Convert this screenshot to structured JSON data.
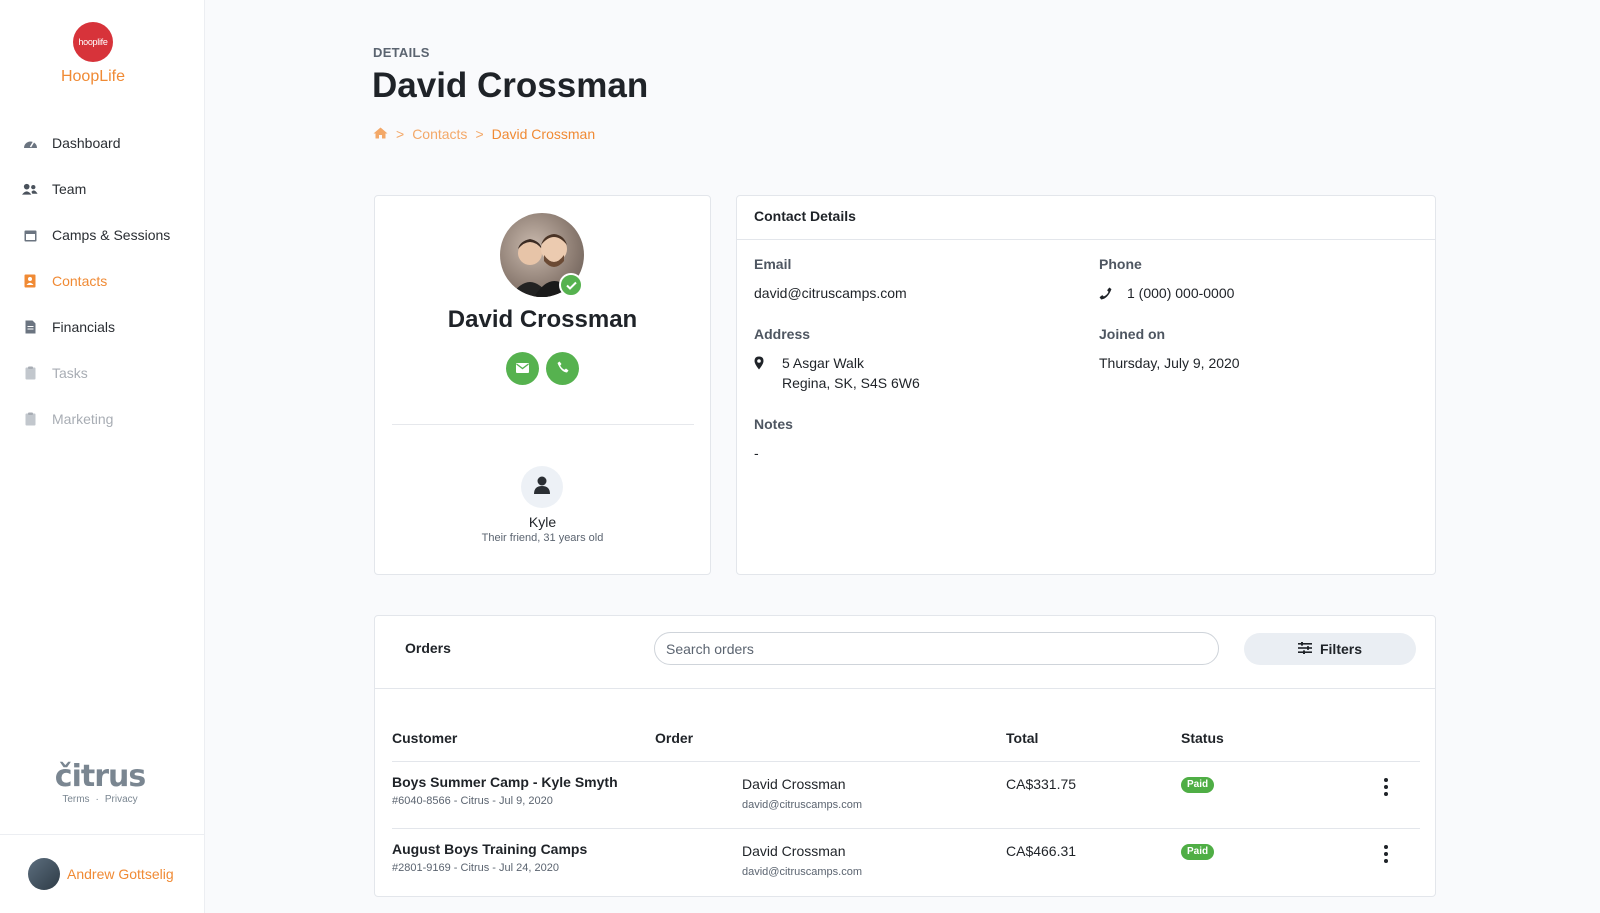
{
  "sidebar": {
    "logo_text": "hooplife",
    "brand": "HoopLife",
    "items": [
      {
        "label": "Dashboard",
        "icon": "dashboard-icon"
      },
      {
        "label": "Team",
        "icon": "team-icon"
      },
      {
        "label": "Camps & Sessions",
        "icon": "calendar-icon"
      },
      {
        "label": "Contacts",
        "icon": "contacts-icon"
      },
      {
        "label": "Financials",
        "icon": "document-icon"
      },
      {
        "label": "Tasks",
        "icon": "clipboard-icon"
      },
      {
        "label": "Marketing",
        "icon": "clipboard-icon"
      }
    ],
    "footer_brand": "čitrus",
    "footer_links": [
      "Terms",
      "·",
      "Privacy"
    ],
    "user_name": "Andrew Gottselig"
  },
  "header": {
    "eyebrow": "DETAILS",
    "title": "David Crossman",
    "breadcrumb": [
      "Contacts",
      "David Crossman"
    ],
    "separator": ">"
  },
  "profile": {
    "name": "David Crossman",
    "friend_name": "Kyle",
    "friend_desc": "Their friend, 31 years old"
  },
  "contact_details": {
    "heading": "Contact Details",
    "email_label": "Email",
    "email": "david@citruscamps.com",
    "phone_label": "Phone",
    "phone": "1 (000) 000-0000",
    "address_label": "Address",
    "address_line1": "5 Asgar Walk",
    "address_line2": "Regina, SK, S4S 6W6",
    "joined_label": "Joined on",
    "joined": "Thursday, July 9, 2020",
    "notes_label": "Notes",
    "notes": "-"
  },
  "orders": {
    "title": "Orders",
    "search_placeholder": "Search orders",
    "filters_label": "Filters",
    "headers": [
      "Customer",
      "Order",
      "Total",
      "Status"
    ],
    "rows": [
      {
        "title": "Boys Summer Camp - Kyle Smyth",
        "meta": "#6040-8566 - Citrus - Jul 9, 2020",
        "customer": "David Crossman",
        "email": "david@citruscamps.com",
        "total": "CA$331.75",
        "status": "Paid"
      },
      {
        "title": "August Boys Training Camps",
        "meta": "#2801-9169 - Citrus - Jul 24, 2020",
        "customer": "David Crossman",
        "email": "david@citruscamps.com",
        "total": "CA$466.31",
        "status": "Paid"
      }
    ]
  },
  "colors": {
    "accent": "#f08a34",
    "success": "#56b24f",
    "brand_red": "#d7333a"
  }
}
